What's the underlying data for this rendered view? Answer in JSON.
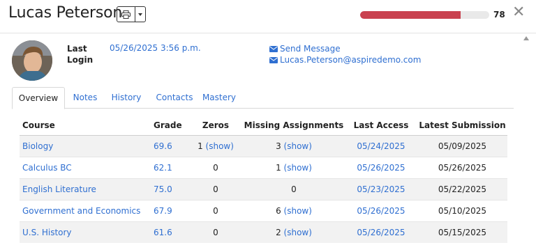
{
  "student": {
    "name": "Lucas Peterson",
    "progress_value": "78",
    "progress_fraction": 0.78,
    "last_login_label": "Last Login",
    "last_login_value": "05/26/2025 3:56 p.m.",
    "send_message_label": "Send Message",
    "email": "Lucas.Peterson@aspiredemo.com"
  },
  "icons": {
    "print": "printer-icon",
    "caret": "chevron-down-icon",
    "close": "close-icon",
    "envelope": "envelope-icon",
    "scroll": "scroll-up-arrow"
  },
  "colors": {
    "progress_fill": "#c9414f",
    "progress_track": "#e9e9e9",
    "link": "#2f6fd1",
    "row_shade": "#f2f2f2"
  },
  "header": {
    "close_glyph": "✕"
  },
  "tabs": [
    {
      "label": "Overview",
      "active": true
    },
    {
      "label": "Notes",
      "active": false
    },
    {
      "label": "History",
      "active": false
    },
    {
      "label": "Contacts",
      "active": false
    },
    {
      "label": "Mastery",
      "active": false
    }
  ],
  "table": {
    "columns": [
      "Course",
      "Grade",
      "Zeros",
      "Missing Assignments",
      "Last Access",
      "Latest Submission"
    ],
    "rows": [
      {
        "course": "Biology",
        "grade": "69.6",
        "zeros": "1",
        "zeros_show": "(show)",
        "missing": "3",
        "missing_show": "(show)",
        "last_access": "05/24/2025",
        "latest_submission": "05/09/2025"
      },
      {
        "course": "Calculus BC",
        "grade": "62.1",
        "zeros": "0",
        "zeros_show": "",
        "missing": "1",
        "missing_show": "(show)",
        "last_access": "05/26/2025",
        "latest_submission": "05/26/2025"
      },
      {
        "course": "English Literature",
        "grade": "75.0",
        "zeros": "0",
        "zeros_show": "",
        "missing": "0",
        "missing_show": "",
        "last_access": "05/23/2025",
        "latest_submission": "05/22/2025"
      },
      {
        "course": "Government and Economics",
        "grade": "67.9",
        "zeros": "0",
        "zeros_show": "",
        "missing": "6",
        "missing_show": "(show)",
        "last_access": "05/26/2025",
        "latest_submission": "05/10/2025"
      },
      {
        "course": "U.S. History",
        "grade": "61.6",
        "zeros": "0",
        "zeros_show": "",
        "missing": "2",
        "missing_show": "(show)",
        "last_access": "05/26/2025",
        "latest_submission": "05/15/2025"
      }
    ]
  }
}
